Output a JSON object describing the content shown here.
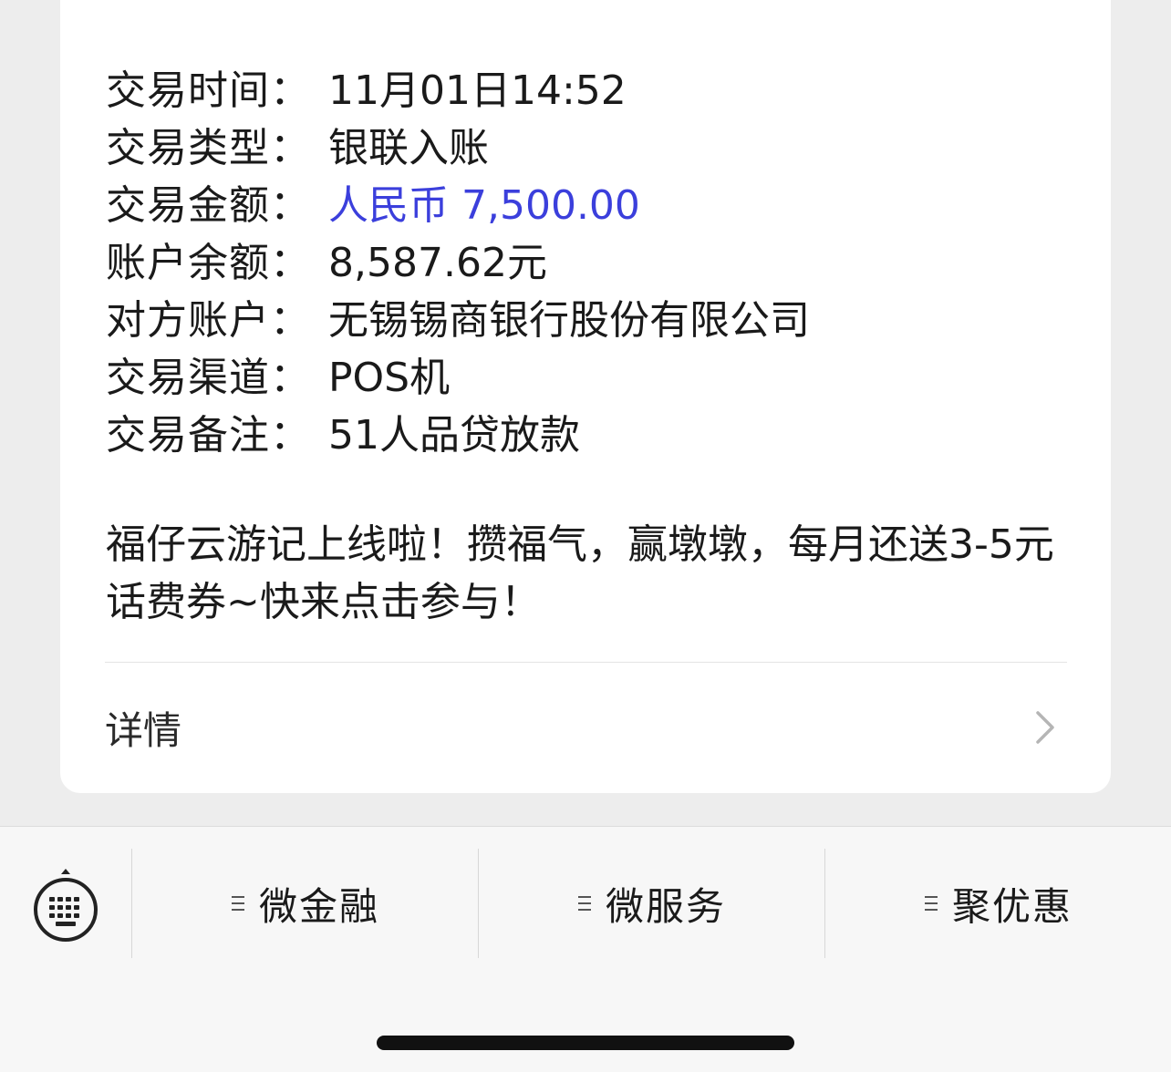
{
  "transaction": {
    "rows": [
      {
        "label": "交易时间：",
        "value": "11月01日14:52"
      },
      {
        "label": "交易类型：",
        "value": "银联入账"
      },
      {
        "label": "交易金额：",
        "value": "人民币 7,500.00"
      },
      {
        "label": "账户余额：",
        "value": "8,587.62元"
      },
      {
        "label": "对方账户：",
        "value": "无锡锡商银行股份有限公司"
      },
      {
        "label": "交易渠道：",
        "value": "POS机"
      },
      {
        "label": "交易备注：",
        "value": "51人品贷放款"
      }
    ],
    "promo": "福仔云游记上线啦！攒福气，赢墩墩，每月还送3-5元话费券~快来点击参与！",
    "detail_label": "详情"
  },
  "bottom_menu": {
    "items": [
      {
        "label": "微金融",
        "icon": "menu-lines-icon"
      },
      {
        "label": "微服务",
        "icon": "menu-lines-icon"
      },
      {
        "label": "聚优惠",
        "icon": "menu-lines-icon"
      }
    ],
    "keyboard_icon": "keyboard-icon"
  },
  "colors": {
    "accent": "#3b3fdc",
    "text": "#1a1a1a",
    "background": "#ededed"
  }
}
